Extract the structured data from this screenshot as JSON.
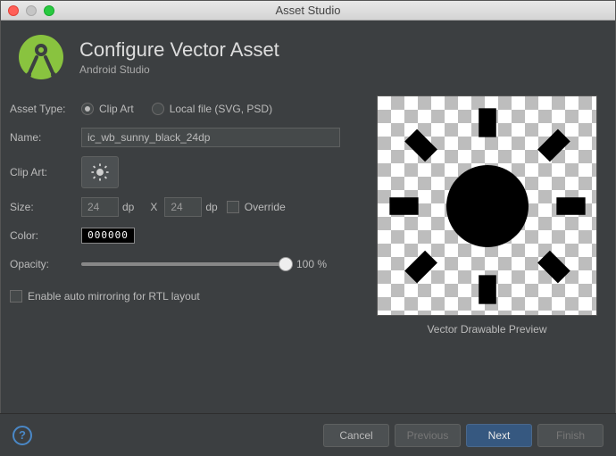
{
  "window": {
    "title": "Asset Studio"
  },
  "header": {
    "title": "Configure Vector Asset",
    "subtitle": "Android Studio"
  },
  "form": {
    "asset_type_label": "Asset Type:",
    "asset_type": {
      "clip_art": "Clip Art",
      "local_file": "Local file (SVG, PSD)",
      "selected": "clip_art"
    },
    "name_label": "Name:",
    "name_value": "ic_wb_sunny_black_24dp",
    "clip_art_label": "Clip Art:",
    "size_label": "Size:",
    "size_width": "24",
    "size_height": "24",
    "size_x": "X",
    "dp": "dp",
    "override_label": "Override",
    "color_label": "Color:",
    "color_value": "000000",
    "opacity_label": "Opacity:",
    "opacity_value": "100 %",
    "rtl_label": "Enable auto mirroring for RTL layout"
  },
  "preview": {
    "caption": "Vector Drawable Preview"
  },
  "footer": {
    "cancel": "Cancel",
    "previous": "Previous",
    "next": "Next",
    "finish": "Finish"
  }
}
